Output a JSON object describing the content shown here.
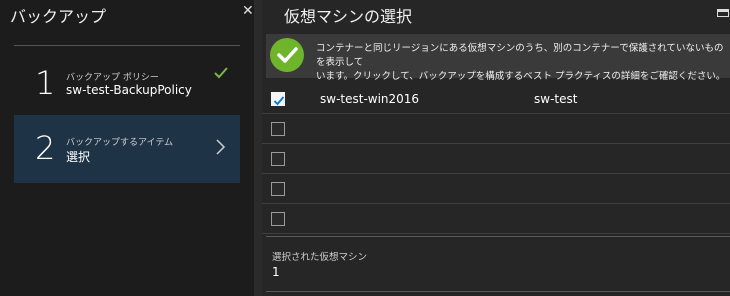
{
  "left_blade": {
    "title": "バックアップ",
    "close_glyph": "✕",
    "steps": [
      {
        "number": "1",
        "label": "バックアップ ポリシー",
        "value": "sw-test-BackupPolicy",
        "status_icon": "checkmark-icon",
        "status_color": "#7ab648"
      },
      {
        "number": "2",
        "label": "バックアップするアイテム",
        "value": "選択",
        "status_icon": "chevron-right-icon"
      }
    ]
  },
  "right_blade": {
    "title": "仮想マシンの選択",
    "info_line1": "コンテナーと同じリージョンにある仮想マシンのうち、別のコンテナーで保護されていないものを表示して",
    "info_line2": "います。クリックして、バックアップを構成するベスト プラクティスの詳細をご確認ください。",
    "info_icon": "success-check-icon",
    "info_icon_color": "#6fb52c",
    "rows": [
      {
        "checked": true,
        "name": "sw-test-win2016",
        "resource_group": "sw-test"
      },
      {
        "checked": false,
        "name": "",
        "resource_group": ""
      },
      {
        "checked": false,
        "name": "",
        "resource_group": ""
      },
      {
        "checked": false,
        "name": "",
        "resource_group": ""
      },
      {
        "checked": false,
        "name": "",
        "resource_group": ""
      }
    ],
    "selected_label": "選択された仮想マシン",
    "selected_count": "1"
  },
  "colors": {
    "background": "#1e1e1e",
    "active_step": "#1f3347",
    "checkbox_accent": "#0078d4"
  }
}
